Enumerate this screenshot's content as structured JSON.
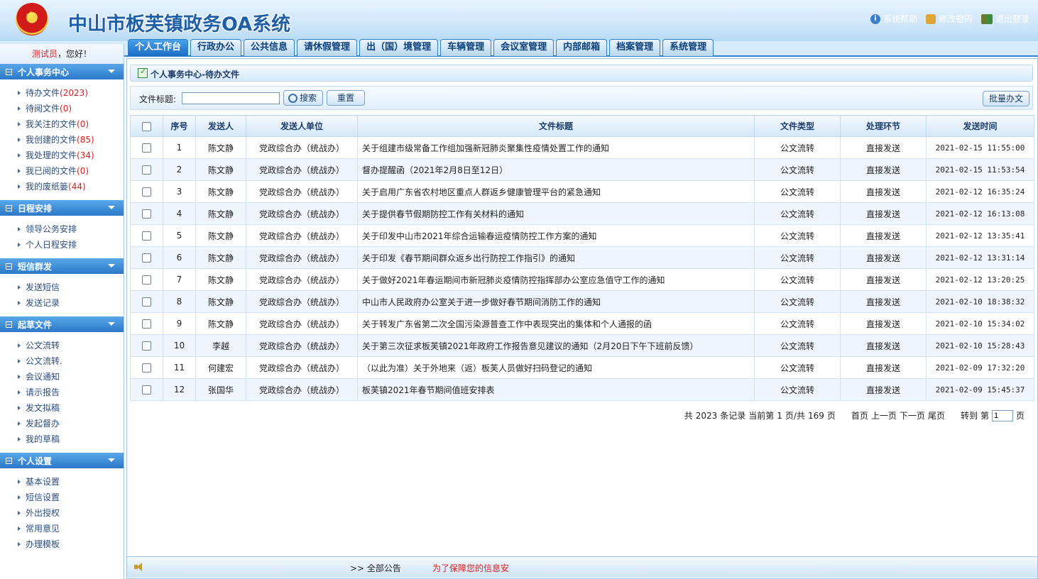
{
  "header": {
    "title": "中山市板芙镇政务OA系统",
    "links": {
      "help": "系统帮助",
      "password": "修改密码",
      "logout": "退出登录"
    }
  },
  "tabs": [
    "个人工作台",
    "行政办公",
    "公共信息",
    "请休假管理",
    "出（国）境管理",
    "车辆管理",
    "会议室管理",
    "内部邮箱",
    "档案管理",
    "系统管理"
  ],
  "sidebar": {
    "user": "测试员",
    "greeting": "，您好！",
    "sections": [
      {
        "title": "个人事务中心",
        "items": [
          {
            "label": "待办文件",
            "count": "(2023)"
          },
          {
            "label": "待阅文件",
            "count": "(0)"
          },
          {
            "label": "我关注的文件",
            "count": "(0)"
          },
          {
            "label": "我创建的文件",
            "count": "(85)"
          },
          {
            "label": "我处理的文件",
            "count": "(34)"
          },
          {
            "label": "我已阅的文件",
            "count": "(0)"
          },
          {
            "label": "我的废纸篓",
            "count": "(44)"
          }
        ]
      },
      {
        "title": "日程安排",
        "items": [
          {
            "label": "领导公务安排",
            "count": ""
          },
          {
            "label": "个人日程安排",
            "count": ""
          }
        ]
      },
      {
        "title": "短信群发",
        "items": [
          {
            "label": "发送短信",
            "count": ""
          },
          {
            "label": "发送记录",
            "count": ""
          }
        ]
      },
      {
        "title": "起草文件",
        "items": [
          {
            "label": "公文流转",
            "count": ""
          },
          {
            "label": "公文流转.",
            "count": ""
          },
          {
            "label": "会议通知",
            "count": ""
          },
          {
            "label": "请示报告",
            "count": ""
          },
          {
            "label": "发文拟稿",
            "count": ""
          },
          {
            "label": "发起督办",
            "count": ""
          },
          {
            "label": "我的草稿",
            "count": ""
          }
        ]
      },
      {
        "title": "个人设置",
        "items": [
          {
            "label": "基本设置",
            "count": ""
          },
          {
            "label": "短信设置",
            "count": ""
          },
          {
            "label": "外出授权",
            "count": ""
          },
          {
            "label": "常用意见",
            "count": ""
          },
          {
            "label": "办理模板",
            "count": ""
          }
        ]
      }
    ]
  },
  "main": {
    "panel_title": "个人事务中心-待办文件",
    "search": {
      "label": "文件标题:",
      "value": "",
      "search_btn": "搜索",
      "reset_btn": "重置",
      "batch_btn": "批量办文"
    },
    "columns": [
      "序号",
      "发送人",
      "发送人单位",
      "文件标题",
      "文件类型",
      "处理环节",
      "发送时间"
    ],
    "rows": [
      [
        "1",
        "陈文静",
        "党政综合办（统战办）",
        "关于组建市级常备工作组加强新冠肺炎聚集性疫情处置工作的通知",
        "公文流转",
        "直接发送",
        "2021-02-15 11:55:00"
      ],
      [
        "2",
        "陈文静",
        "党政综合办（统战办）",
        "督办提醒函（2021年2月8日至12日）",
        "公文流转",
        "直接发送",
        "2021-02-15 11:53:54"
      ],
      [
        "3",
        "陈文静",
        "党政综合办（统战办）",
        "关于启用广东省农村地区重点人群返乡健康管理平台的紧急通知",
        "公文流转",
        "直接发送",
        "2021-02-12 16:35:24"
      ],
      [
        "4",
        "陈文静",
        "党政综合办（统战办）",
        "关于提供春节假期防控工作有关材料的通知",
        "公文流转",
        "直接发送",
        "2021-02-12 16:13:08"
      ],
      [
        "5",
        "陈文静",
        "党政综合办（统战办）",
        "关于印发中山市2021年综合运输春运疫情防控工作方案的通知",
        "公文流转",
        "直接发送",
        "2021-02-12 13:35:41"
      ],
      [
        "6",
        "陈文静",
        "党政综合办（统战办）",
        "关于印发《春节期间群众返乡出行防控工作指引》的通知",
        "公文流转",
        "直接发送",
        "2021-02-12 13:31:14"
      ],
      [
        "7",
        "陈文静",
        "党政综合办（统战办）",
        "关于做好2021年春运期间市新冠肺炎疫情防控指挥部办公室应急值守工作的通知",
        "公文流转",
        "直接发送",
        "2021-02-12 13:20:25"
      ],
      [
        "8",
        "陈文静",
        "党政综合办（统战办）",
        "中山市人民政府办公室关于进一步做好春节期间消防工作的通知",
        "公文流转",
        "直接发送",
        "2021-02-10 18:38:32"
      ],
      [
        "9",
        "陈文静",
        "党政综合办（统战办）",
        "关于转发广东省第二次全国污染源普查工作中表现突出的集体和个人通报的函",
        "公文流转",
        "直接发送",
        "2021-02-10 15:34:02"
      ],
      [
        "10",
        "李越",
        "党政综合办（统战办）",
        "关于第三次征求板芙镇2021年政府工作报告意见建议的通知（2月20日下午下班前反馈）",
        "公文流转",
        "直接发送",
        "2021-02-10 15:28:43"
      ],
      [
        "11",
        "何建宏",
        "党政综合办（统战办）",
        "（以此为准）关于外地来（返）板芙人员做好扫码登记的通知",
        "公文流转",
        "直接发送",
        "2021-02-09 17:32:20"
      ],
      [
        "12",
        "张国华",
        "党政综合办（统战办）",
        "板芙镇2021年春节期间值班安排表",
        "公文流转",
        "直接发送",
        "2021-02-09 15:45:37"
      ]
    ],
    "pager": {
      "total_prefix": "共",
      "total": "2023",
      "total_suffix": "条记录",
      "current_prefix": "当前第",
      "current": "1",
      "current_mid": "页/共",
      "pages": "169",
      "pages_suffix": "页",
      "first": "首页",
      "prev": "上一页",
      "next": "下一页",
      "last": "尾页",
      "goto_prefix": "转到",
      "goto_di": "第",
      "goto_value": "1",
      "goto_suffix": "页"
    }
  },
  "notice": {
    "all": ">> 全部公告",
    "message": "为了保障您的信息安"
  }
}
